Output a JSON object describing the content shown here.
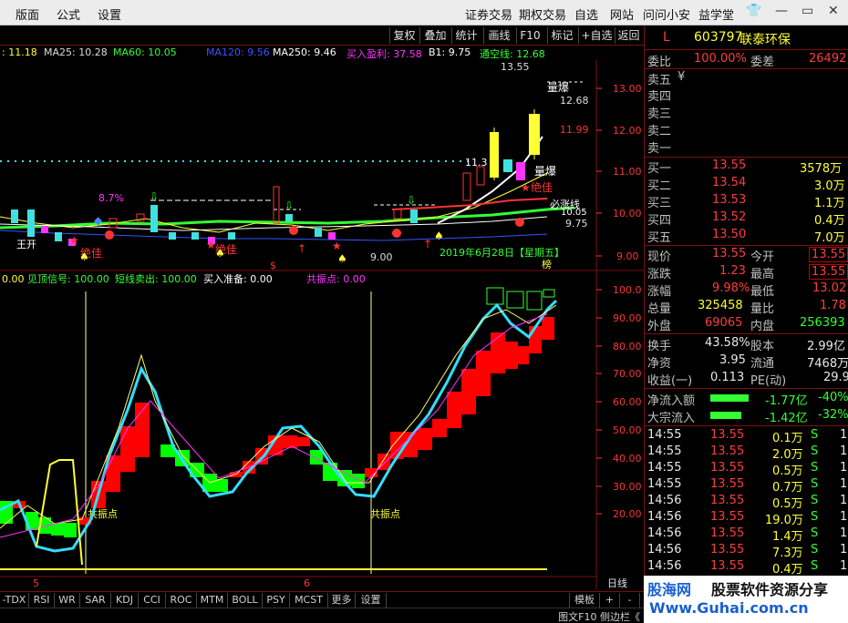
{
  "menu": {
    "left": [
      "版面",
      "公式",
      "设置"
    ],
    "right": [
      "证券交易",
      "期权交易",
      "自选",
      "网站",
      "问问小安",
      "益学堂"
    ]
  },
  "toolbar": [
    "复权",
    "叠加",
    "统计",
    "画线",
    "F10",
    "标记",
    "+自选",
    "返回"
  ],
  "ma_row": {
    "ma1": ": 11.18",
    "ma25": "MA25: 10.28",
    "ma60": "MA60: 10.05",
    "ma120": "MA120: 9.56",
    "ma250": "MA250: 9.46",
    "buy_profit": "买入盈利: 37.58",
    "b1": "B1: 9.75",
    "tong": "通空线: 12.68"
  },
  "main_chart": {
    "yaxis": [
      "13.00",
      "12.00",
      "11.00",
      "10.00",
      "9.00"
    ],
    "annotations": {
      "high": "13.55",
      "liangbao1": "量爆",
      "level_1268": "12.68",
      "level_1199": "11.99",
      "level_113": "11.3",
      "liangbao2": "量爆",
      "juejia1": "绝佳",
      "bimai": "必涨线",
      "level_1005": "10.05",
      "level_975": "9.75",
      "pct": "8.7%",
      "low_900": "9.00",
      "date": "2019年6月28日【星期五】",
      "bang": "榜",
      "juejia2": "绝佳",
      "juejia3": "绝佳",
      "wang": "王开"
    }
  },
  "indicator": {
    "header_0": "0.00",
    "header_1": "见顶信号: 100.00",
    "header_2": "短线卖出: 100.00",
    "header_3": "买入准备: 0.00",
    "header_4": "共振点: 0.00",
    "yaxis": [
      "100.0",
      "90.00",
      "80.00",
      "70.00",
      "60.00",
      "50.00",
      "40.00",
      "30.00",
      "20.00"
    ],
    "gz1": "共振点",
    "gz2": "共振点",
    "month_5": "5",
    "month_6": "6",
    "rixian": "日线"
  },
  "tabs": [
    "-TDX",
    "RSI",
    "WR",
    "SAR",
    "KDJ",
    "CCI",
    "ROC",
    "MTM",
    "BOLL",
    "PSY",
    "MCST",
    "更多",
    "设置"
  ],
  "tabs_right": [
    "模板",
    "+",
    "-"
  ],
  "status": "图文F10 侧边栏《",
  "quote": {
    "code": "603797",
    "name": "联泰环保",
    "mark": "L",
    "weibi_label": "委比",
    "weibi": "100.00%",
    "weicha_label": "委差",
    "weicha": "26492",
    "sell": [
      {
        "label": "卖五",
        "price": "¥",
        "vol": ""
      },
      {
        "label": "卖四",
        "price": "",
        "vol": ""
      },
      {
        "label": "卖三",
        "price": "",
        "vol": ""
      },
      {
        "label": "卖二",
        "price": "",
        "vol": ""
      },
      {
        "label": "卖一",
        "price": "",
        "vol": ""
      }
    ],
    "buy": [
      {
        "label": "买一",
        "price": "13.55",
        "vol": "3578万"
      },
      {
        "label": "买二",
        "price": "13.54",
        "vol": "3.0万"
      },
      {
        "label": "买三",
        "price": "13.53",
        "vol": "1.1万"
      },
      {
        "label": "买四",
        "price": "13.52",
        "vol": "0.4万"
      },
      {
        "label": "买五",
        "price": "13.50",
        "vol": "7.0万"
      }
    ],
    "stats": [
      {
        "l1": "现价",
        "v1": "13.55",
        "l2": "今开",
        "v2": "13.55"
      },
      {
        "l1": "涨跌",
        "v1": "1.23",
        "l2": "最高",
        "v2": "13.55"
      },
      {
        "l1": "涨幅",
        "v1": "9.98%",
        "l2": "最低",
        "v2": "13.02"
      },
      {
        "l1": "总量",
        "v1": "325458",
        "l2": "量比",
        "v2": "1.78"
      },
      {
        "l1": "外盘",
        "v1": "69065",
        "l2": "内盘",
        "v2": "256393"
      }
    ],
    "stats2": [
      {
        "l1": "换手",
        "v1": "43.58%",
        "l2": "股本",
        "v2": "2.99亿"
      },
      {
        "l1": "净资",
        "v1": "3.95",
        "l2": "流通",
        "v2": "7468万"
      },
      {
        "l1": "收益(一)",
        "v1": "0.113",
        "l2": "PE(动)",
        "v2": "29.9"
      }
    ],
    "flow": [
      {
        "label": "净流入额",
        "value": "-1.77亿",
        "pct": "-40%"
      },
      {
        "label": "大宗流入",
        "value": "-1.42亿",
        "pct": "-32%"
      }
    ],
    "ticks": [
      {
        "t": "14:55",
        "p": "13.55",
        "v": "0.1万",
        "s": "S",
        "n": "1"
      },
      {
        "t": "14:55",
        "p": "13.55",
        "v": "2.0万",
        "s": "S",
        "n": "1"
      },
      {
        "t": "14:55",
        "p": "13.55",
        "v": "0.5万",
        "s": "S",
        "n": "1"
      },
      {
        "t": "14:55",
        "p": "13.55",
        "v": "0.7万",
        "s": "S",
        "n": "1"
      },
      {
        "t": "14:56",
        "p": "13.55",
        "v": "0.5万",
        "s": "S",
        "n": "1"
      },
      {
        "t": "14:56",
        "p": "13.55",
        "v": "19.0万",
        "s": "S",
        "n": "1"
      },
      {
        "t": "14:56",
        "p": "13.55",
        "v": "1.4万",
        "s": "S",
        "n": "1"
      },
      {
        "t": "14:56",
        "p": "13.55",
        "v": "7.3万",
        "s": "S",
        "n": "1"
      },
      {
        "t": "14:56",
        "p": "13.55",
        "v": "0.4万",
        "s": "S",
        "n": "1"
      }
    ]
  },
  "watermark": {
    "site": "股海网",
    "slogan": "股票软件资源分享",
    "url": "Www.Guhai.com.cn"
  }
}
